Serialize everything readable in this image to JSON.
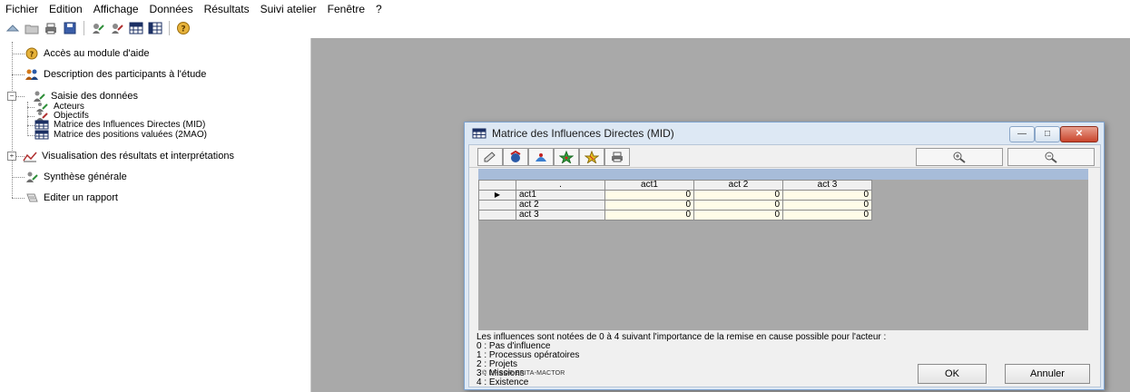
{
  "menu": [
    "Fichier",
    "Edition",
    "Affichage",
    "Données",
    "Résultats",
    "Suivi atelier",
    "Fenêtre",
    "?"
  ],
  "toolbar_icons": [
    "open-arrow-icon",
    "folder-icon",
    "print-icon",
    "save-icon",
    "actors-icon",
    "objectives-icon",
    "matrix-mid-icon",
    "matrix-2mao-icon",
    "help-icon"
  ],
  "tree": {
    "help_module": "Accès au module d'aide",
    "participants": "Description des participants à l'étude",
    "data_entry": "Saisie des données",
    "actors": "Acteurs",
    "objectives": "Objectifs",
    "mid": "Matrice des Influences Directes (MID)",
    "mao": "Matrice des positions valuées (2MAO)",
    "results": "Visualisation des résultats et interprétations",
    "synthesis": "Synthèse générale",
    "report": "Editer un rapport"
  },
  "window": {
    "title": "Matrice des Influences Directes (MID)",
    "minimize_label": "—",
    "maximize_label": "□",
    "close_label": "✕"
  },
  "matrix": {
    "corner": ".",
    "columns": [
      "act1",
      "act 2",
      "act 3"
    ],
    "rows": [
      {
        "marker": "▶",
        "label": "act1",
        "values": [
          "0",
          "0",
          "0"
        ]
      },
      {
        "marker": "",
        "label": "act 2",
        "values": [
          "0",
          "0",
          "0"
        ]
      },
      {
        "marker": "",
        "label": "act 3",
        "values": [
          "0",
          "0",
          "0"
        ]
      }
    ]
  },
  "legend": {
    "intro": "Les influences sont notées de 0 à 4 suivant l'importance de la remise en cause possible pour l'acteur :",
    "items": [
      "0 : Pas d'influence",
      "1 : Processus opératoires",
      "2 : Projets",
      "3 : Missions",
      "4 : Existence"
    ]
  },
  "footer": {
    "copyright": "© LIPSOR-EPITA-MACTOR",
    "ok_label": "OK",
    "cancel_label": "Annuler"
  },
  "colors": {
    "workspace": "#a9a9a9",
    "selection_bar": "#a7bcd9",
    "cell_fill": "#fffce8"
  }
}
